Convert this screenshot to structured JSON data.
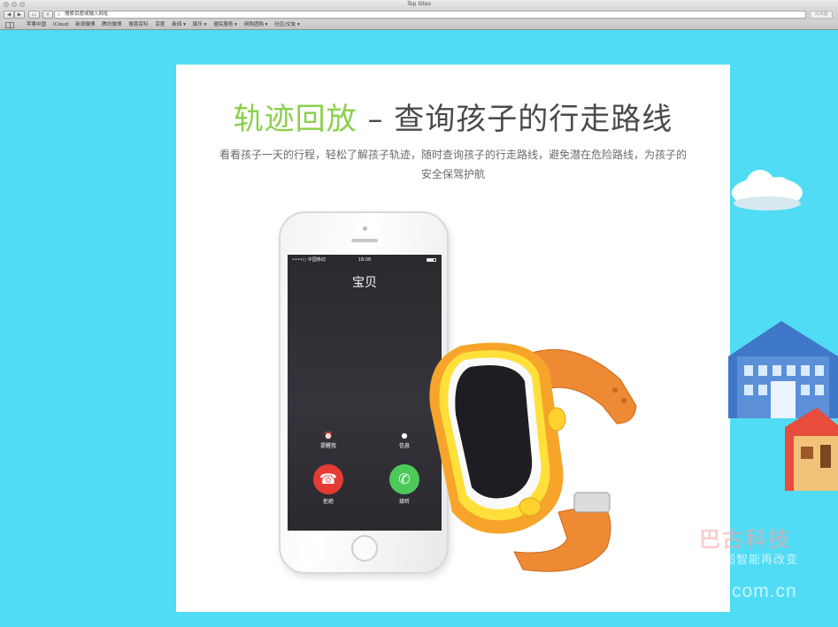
{
  "window": {
    "title": "Top Sites",
    "back": "◀",
    "forward": "▶",
    "address_placeholder": "搜索百度或输入网址",
    "reader_label": "阅读器",
    "bookmarks": [
      "苹果中国",
      "iCloud",
      "新浪微博",
      "腾讯微博",
      "搜喜百科",
      "百度",
      "新闻 ▾",
      "娱乐 ▾",
      "便民服务 ▾",
      "网购团购 ▾",
      "社区/交友 ▾"
    ]
  },
  "page": {
    "headline_highlight": "轨迹回放",
    "headline_rest": " – 查询孩子的行走路线",
    "description": "看看孩子一天的行程，轻松了解孩子轨迹，随时查询孩子的行走路线，避免潜在危险路线，为孩子的安全保驾护航"
  },
  "phone_screen": {
    "carrier": "••••○ 中国移动",
    "time": "18:08",
    "caller": "宝贝",
    "remind_label": "提醒我",
    "message_label": "信息",
    "decline_label": "拒绝",
    "accept_label": "接听"
  },
  "watermark": {
    "brand": "巴古科技",
    "slogan": "产品图智能再改变",
    "url": "www.bgu.com.cn"
  },
  "colors": {
    "background": "#4fdcf4",
    "headline_highlight": "#8ccf4d",
    "decline": "#e63b34",
    "accept": "#4cc95a",
    "watch_body": "#f7a52a",
    "watch_bezel": "#ffe03a",
    "strap": "#ee8a34"
  }
}
